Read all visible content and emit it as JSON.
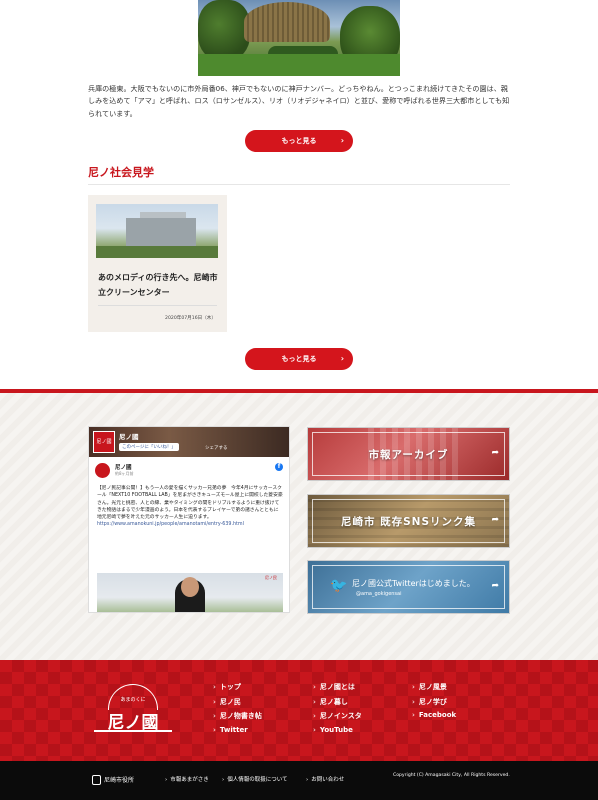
{
  "intro": {
    "text": "兵庫の極東。大阪でもないのに市外局番06、神戸でもないのに神戸ナンバー。どっちやねん。とつっこまれ続けてきたその園は、親しみを込めて「アマ」と呼ばれ、ロス（ロサンゼルス）、リオ（リオデジャネイロ）と並び、愛称で呼ばれる世界三大都市としても知られています。"
  },
  "buttons": {
    "more_label": "もっと見る"
  },
  "section": {
    "title": "尼ノ社会見学",
    "card": {
      "title": "あのメロディの行き先へ。尼崎市立クリーンセンター",
      "date": "2020年07月16日（木）"
    }
  },
  "facebook": {
    "page_name": "尼ノ國",
    "like_label": "このページに「いいね！」",
    "share_label": "シェアする",
    "post_name": "尼ノ國",
    "post_date": "約8ヶ月前",
    "post_text": "【尼ノ民記事公開！】もう一人の愛を描くサッカー兄弟の夢　今年4月にサッカースクール「NEXT10 FOOTBALL LAB」を尼まがさきキューズモール屋上に開校した菱安豪さん。光元と挑密、人との縁、業やタイミングの間をドリブルするように重け抜けてきた物語はまるで少年漫画のよう。日本を代表するプレイヤーで弟の諸さんとともに地元尼崎で夢を叶えた元のサッカー人生に迫ります。",
    "post_link": "https://www.amanokuni.jp/people/amanotami/entry-639.html",
    "badge_text": "尼ノ民"
  },
  "banners": {
    "archive": "市報アーカイブ",
    "sns": "尼崎市 既存SNSリンク集",
    "twitter_title": "尼ノ國公式Twitterはじめました。",
    "twitter_handle": "@ama_gokigensai"
  },
  "footer": {
    "logo_sub": "あまのくに",
    "logo_main": "尼ノ國",
    "nav_col1": [
      "トップ",
      "尼ノ民",
      "尼ノ物書き帖",
      "Twitter"
    ],
    "nav_col2": [
      "尼ノ國とは",
      "尼ノ暮し",
      "尼ノインスタ",
      "YouTube"
    ],
    "nav_col3": [
      "尼ノ風景",
      "尼ノ学び",
      "Facebook"
    ]
  },
  "bottom": {
    "city": "尼崎市役所",
    "links": [
      "市報あまがさき",
      "個人情報の取扱について",
      "お問い合わせ"
    ],
    "copyright": "Copyright (C) Amagasaki City, All Rights Reserved."
  },
  "colors": {
    "brand_red": "#c8161d",
    "footer_black": "#0b0b0b"
  },
  "icons": {
    "chevron": "chevron-right-icon",
    "facebook": "facebook-icon",
    "twitter": "twitter-icon"
  }
}
